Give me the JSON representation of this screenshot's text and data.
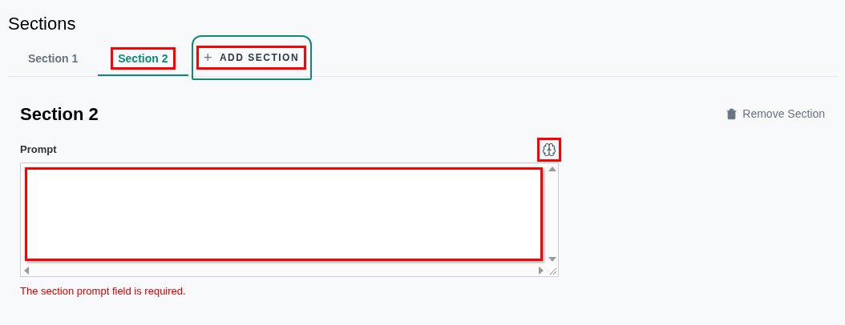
{
  "title": "Sections",
  "tabs": [
    {
      "label": "Section 1",
      "selected": false,
      "highlighted": false
    },
    {
      "label": "Section 2",
      "selected": true,
      "highlighted": true
    }
  ],
  "add_button": {
    "label": "ADD SECTION",
    "icon": "+",
    "highlighted": true
  },
  "section": {
    "heading": "Section 2",
    "remove_label": "Remove Section",
    "prompt": {
      "label": "Prompt",
      "ai_icon_highlighted": true,
      "field_highlighted": true,
      "error": "The section prompt field is required."
    }
  }
}
